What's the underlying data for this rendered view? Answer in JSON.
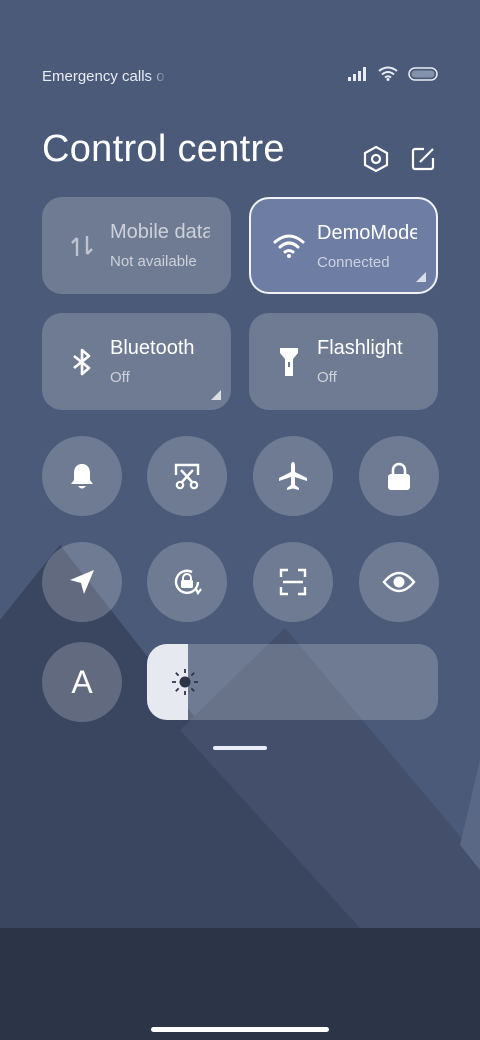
{
  "status_bar": {
    "carrier_text": "Emergency calls o",
    "icons": [
      "signal-icon",
      "wifi-icon",
      "battery-icon"
    ]
  },
  "header": {
    "title": "Control centre",
    "settings_icon": "settings-hexagon-icon",
    "edit_icon": "edit-icon"
  },
  "tiles": [
    {
      "label": "Mobile data",
      "sub": "Not available",
      "icon": "mobile-data-icon",
      "active": false
    },
    {
      "label": "DemoMode",
      "sub": "Connected",
      "icon": "wifi-icon",
      "active": true
    },
    {
      "label": "Bluetooth",
      "sub": "Off",
      "icon": "bluetooth-icon",
      "active": false
    },
    {
      "label": "Flashlight",
      "sub": "Off",
      "icon": "flashlight-icon",
      "active": false
    }
  ],
  "toggles_row1": [
    "bell-icon",
    "screenshot-icon",
    "airplane-icon",
    "lock-icon"
  ],
  "toggles_row2": [
    "location-icon",
    "rotation-lock-icon",
    "scan-icon",
    "eye-icon"
  ],
  "auto_brightness": {
    "label": "A"
  },
  "brightness": {
    "level": 0.14,
    "icon": "sun-icon"
  },
  "colors": {
    "background": "#4b5a78",
    "tile_bg": "rgba(255,255,255,0.20)",
    "active_tile": "#788ab2",
    "dock": "#2c3447"
  }
}
